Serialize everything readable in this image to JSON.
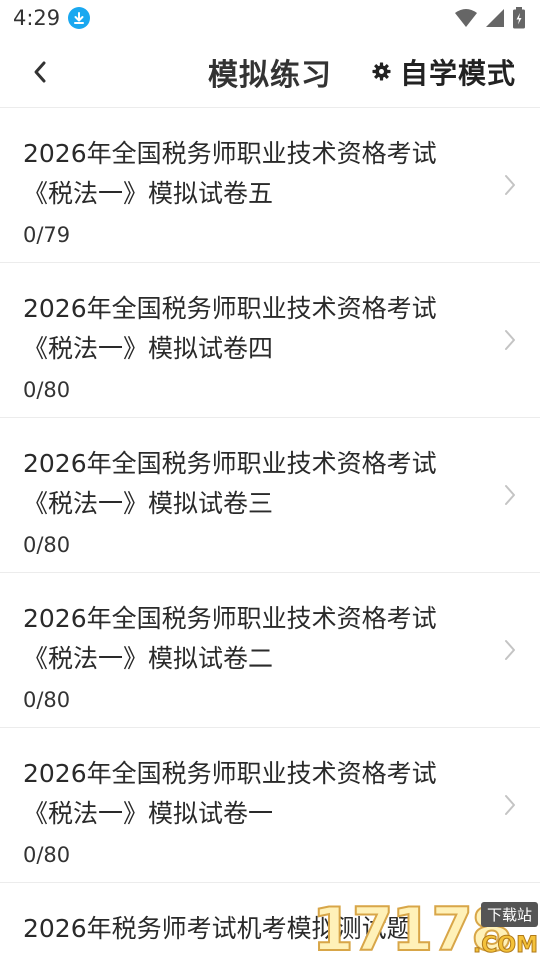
{
  "status": {
    "time": "4:29"
  },
  "header": {
    "title": "模拟练习",
    "mode_label": "自学模式"
  },
  "items": [
    {
      "title_line1": "2026年全国税务师职业技术资格考试",
      "title_line2": "《税法一》模拟试卷五",
      "progress": "0/79"
    },
    {
      "title_line1": "2026年全国税务师职业技术资格考试",
      "title_line2": "《税法一》模拟试卷四",
      "progress": "0/80"
    },
    {
      "title_line1": "2026年全国税务师职业技术资格考试",
      "title_line2": "《税法一》模拟试卷三",
      "progress": "0/80"
    },
    {
      "title_line1": "2026年全国税务师职业技术资格考试",
      "title_line2": "《税法一》模拟试卷二",
      "progress": "0/80"
    },
    {
      "title_line1": "2026年全国税务师职业技术资格考试",
      "title_line2": "《税法一》模拟试卷一",
      "progress": "0/80"
    }
  ],
  "partial_item": {
    "title_line1": "2026年税务师考试机考模拟测试题"
  },
  "watermark": {
    "digits": "17178",
    "tag": "下载站",
    "suffix": ".COM"
  }
}
